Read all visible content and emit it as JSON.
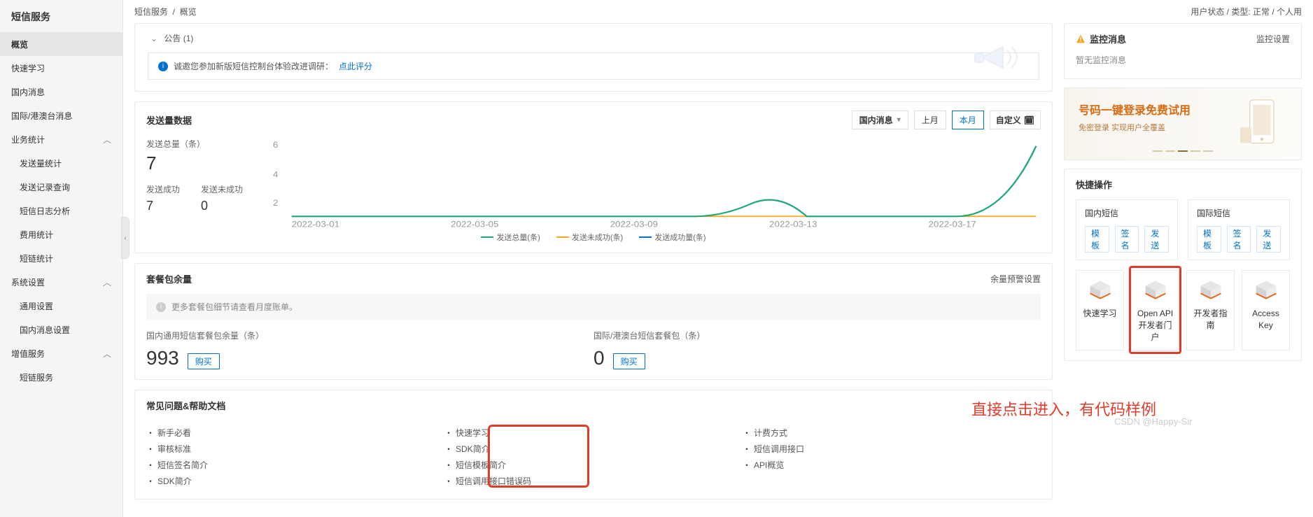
{
  "breadcrumb": {
    "a": "短信服务",
    "b": "概览"
  },
  "userstate": {
    "label": "用户状态 / 类型: 正常 / 个人用"
  },
  "sidebar": {
    "title": "短信服务",
    "items": [
      {
        "label": "概览"
      },
      {
        "label": "快速学习"
      },
      {
        "label": "国内消息"
      },
      {
        "label": "国际/港澳台消息"
      },
      {
        "label": "业务统计"
      },
      {
        "label": "系统设置"
      },
      {
        "label": "增值服务"
      }
    ],
    "s4": [
      "发送量统计",
      "发送记录查询",
      "短信日志分析",
      "费用统计",
      "短链统计"
    ],
    "s5": [
      "通用设置",
      "国内消息设置"
    ],
    "s6": [
      "短链服务"
    ]
  },
  "announce": {
    "head": "公告 (1)",
    "text": "诚邀您参加新版短信控制台体验改进调研：",
    "link": "点此评分"
  },
  "data_card": {
    "title": "发送量数据",
    "filter": "国内消息",
    "prev": "上月",
    "cur": "本月",
    "custom": "自定义",
    "total_label": "发送总量（条）",
    "total": "7",
    "succ_label": "发送成功",
    "succ": "7",
    "fail_label": "发送未成功",
    "fail": "0",
    "legend_total": "发送总量(条)",
    "legend_fail": "发送未成功(条)",
    "legend_succ": "发送成功量(条)",
    "x_ticks": [
      "2022-03-01",
      "2022-03-05",
      "2022-03-09",
      "2022-03-13",
      "2022-03-17"
    ]
  },
  "chart_data": {
    "type": "line",
    "x": [
      "2022-03-01",
      "2022-03-03",
      "2022-03-05",
      "2022-03-07",
      "2022-03-09",
      "2022-03-11",
      "2022-03-13",
      "2022-03-15",
      "2022-03-17",
      "2022-03-19",
      "2022-03-20"
    ],
    "series": [
      {
        "name": "发送总量(条)",
        "values": [
          0,
          0,
          0,
          0,
          0,
          0,
          1,
          0,
          0,
          0,
          6
        ]
      },
      {
        "name": "发送未成功(条)",
        "values": [
          0,
          0,
          0,
          0,
          0,
          0,
          0,
          0,
          0,
          0,
          0
        ]
      },
      {
        "name": "发送成功量(条)",
        "values": [
          0,
          0,
          0,
          0,
          0,
          0,
          0,
          0,
          0,
          0,
          0
        ]
      }
    ],
    "ylim": [
      0,
      6
    ],
    "xlabel": "",
    "ylabel": "",
    "title": "发送量数据"
  },
  "pkg": {
    "title": "套餐包余量",
    "link": "余量预警设置",
    "notice": "更多套餐包细节请查看月度账单。",
    "dom_label": "国内通用短信套餐包余量（条）",
    "dom_val": "993",
    "intl_label": "国际/港澳台短信套餐包（条）",
    "intl_val": "0",
    "buy": "购买"
  },
  "faq": {
    "title": "常见问题&帮助文档",
    "c1": [
      "新手必看",
      "审核标准",
      "短信签名简介",
      "SDK简介"
    ],
    "c2": [
      "快速学习",
      "SDK简介",
      "短信模板简介",
      "短信调用接口错误码"
    ],
    "c3": [
      "计费方式",
      "短信调用接口",
      "API概览"
    ]
  },
  "monitor": {
    "title": "监控消息",
    "link": "监控设置",
    "empty": "暂无监控消息"
  },
  "banner": {
    "t1": "号码一键登录免费试用",
    "t2": "免密登录 实现用户全覆盖"
  },
  "quick": {
    "title": "快捷操作",
    "dom": "国内短信",
    "intl": "国际短信",
    "tags": [
      "模板",
      "签名",
      "发送"
    ],
    "btns": [
      "快速学习",
      "Open API开发者门户",
      "开发者指南",
      "Access Key"
    ]
  },
  "annotation": "直接点击进入，有代码样例",
  "watermark": "CSDN @Happy-Sir",
  "colors": {
    "primary": "#0070cc",
    "red": "#e13b2b",
    "green": "#1ea87a",
    "orange": "#f5a623"
  }
}
